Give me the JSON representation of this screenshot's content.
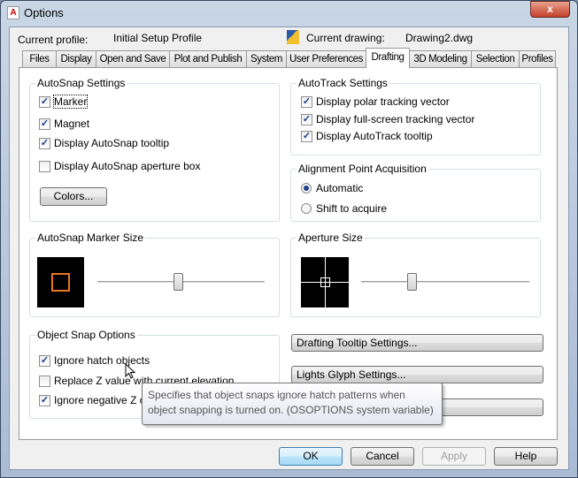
{
  "window": {
    "title": "Options",
    "close": "x"
  },
  "header": {
    "profile_label": "Current profile:",
    "profile_value": "Initial Setup Profile",
    "drawing_label": "Current drawing:",
    "drawing_value": "Drawing2.dwg"
  },
  "tabs": [
    "Files",
    "Display",
    "Open and Save",
    "Plot and Publish",
    "System",
    "User Preferences",
    "Drafting",
    "3D Modeling",
    "Selection",
    "Profiles"
  ],
  "active_tab": "Drafting",
  "autosnap": {
    "title": "AutoSnap Settings",
    "items": [
      {
        "label": "Marker",
        "checked": true
      },
      {
        "label": "Magnet",
        "checked": true
      },
      {
        "label": "Display AutoSnap tooltip",
        "checked": true
      },
      {
        "label": "Display AutoSnap aperture box",
        "checked": false
      }
    ],
    "colors_button": "Colors..."
  },
  "autotrack": {
    "title": "AutoTrack Settings",
    "items": [
      {
        "label": "Display polar tracking vector",
        "checked": true
      },
      {
        "label": "Display full-screen tracking vector",
        "checked": true
      },
      {
        "label": "Display AutoTrack tooltip",
        "checked": true
      }
    ]
  },
  "alignment": {
    "title": "Alignment Point Acquisition",
    "options": [
      {
        "label": "Automatic",
        "selected": true
      },
      {
        "label": "Shift to acquire",
        "selected": false
      }
    ]
  },
  "marker_size": {
    "title": "AutoSnap Marker Size",
    "slider_percent": 48,
    "marker_color": "#e87722"
  },
  "aperture_size": {
    "title": "Aperture Size",
    "slider_percent": 30
  },
  "osnap": {
    "title": "Object Snap Options",
    "items": [
      {
        "label": "Ignore hatch objects",
        "checked": true
      },
      {
        "label": "Replace Z value with current elevation",
        "checked": false
      },
      {
        "label": "Ignore negative Z object snaps for Dynamic UCS",
        "checked": true
      }
    ]
  },
  "right_buttons": {
    "drafting_tooltip": "Drafting Tooltip Settings...",
    "lights_glyph": "Lights Glyph Settings..."
  },
  "tooltip": "Specifies that object snaps ignore hatch patterns when object snapping is turned on. (OSOPTIONS system variable)",
  "footer": {
    "ok": "OK",
    "cancel": "Cancel",
    "apply": "Apply",
    "help": "Help"
  }
}
